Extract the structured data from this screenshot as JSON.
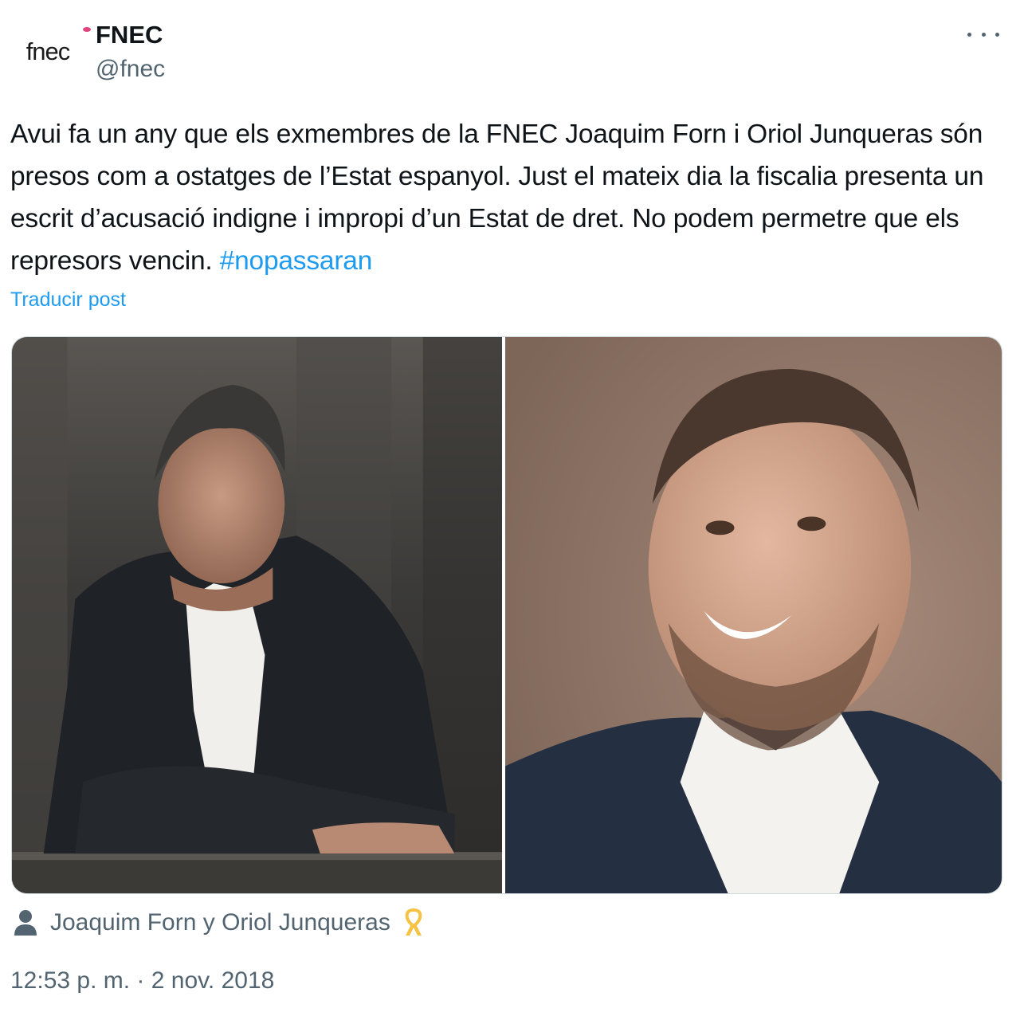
{
  "account": {
    "avatar_text": "fnec",
    "name": "FNEC",
    "handle": "@fnec"
  },
  "post": {
    "text": "Avui fa un any que els exmembres de la FNEC Joaquim Forn i Oriol Junqueras són presos com a ostatges de l’Estat espanyol. Just el mateix dia la fiscalia presenta un escrit d’acusació indigne i impropi d’un Estat de dret. No podem permetre que els represors vencin.",
    "hashtag": "#nopassaran",
    "translate_label": "Traducir post",
    "tagged_people": "Joaquim Forn y Oriol Junqueras",
    "timestamp": "12:53 p. m. · 2 nov. 2018"
  },
  "icons": {
    "more": "more-options-icon",
    "tagged": "person-icon",
    "ribbon": "yellow-ribbon-icon"
  },
  "colors": {
    "link": "#1d9bf0",
    "secondary_text": "#536471",
    "primary_text": "#0f1419",
    "ribbon": "#f6c244"
  }
}
